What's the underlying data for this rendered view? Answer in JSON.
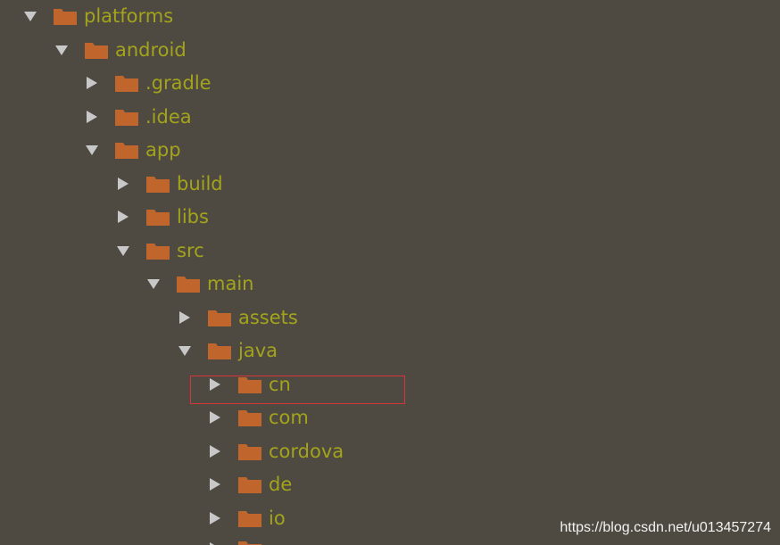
{
  "colors": {
    "background": "#4e4a41",
    "label": "#a3a31c",
    "folder": "#c0652b",
    "arrow": "#c8c8c8",
    "highlight_border": "#d8343a"
  },
  "tree": [
    {
      "label": "platforms",
      "expanded": true
    },
    {
      "label": "android",
      "expanded": true
    },
    {
      "label": ".gradle",
      "expanded": false
    },
    {
      "label": ".idea",
      "expanded": false
    },
    {
      "label": "app",
      "expanded": true
    },
    {
      "label": "build",
      "expanded": false
    },
    {
      "label": "libs",
      "expanded": false
    },
    {
      "label": "src",
      "expanded": true
    },
    {
      "label": "main",
      "expanded": true
    },
    {
      "label": "assets",
      "expanded": false
    },
    {
      "label": "java",
      "expanded": true
    },
    {
      "label": "cn",
      "expanded": false,
      "highlighted": true
    },
    {
      "label": "com",
      "expanded": false
    },
    {
      "label": "cordova",
      "expanded": false
    },
    {
      "label": "de",
      "expanded": false
    },
    {
      "label": "io",
      "expanded": false
    },
    {
      "label": "",
      "expanded": false
    }
  ],
  "watermark": "https://blog.csdn.net/u013457274"
}
